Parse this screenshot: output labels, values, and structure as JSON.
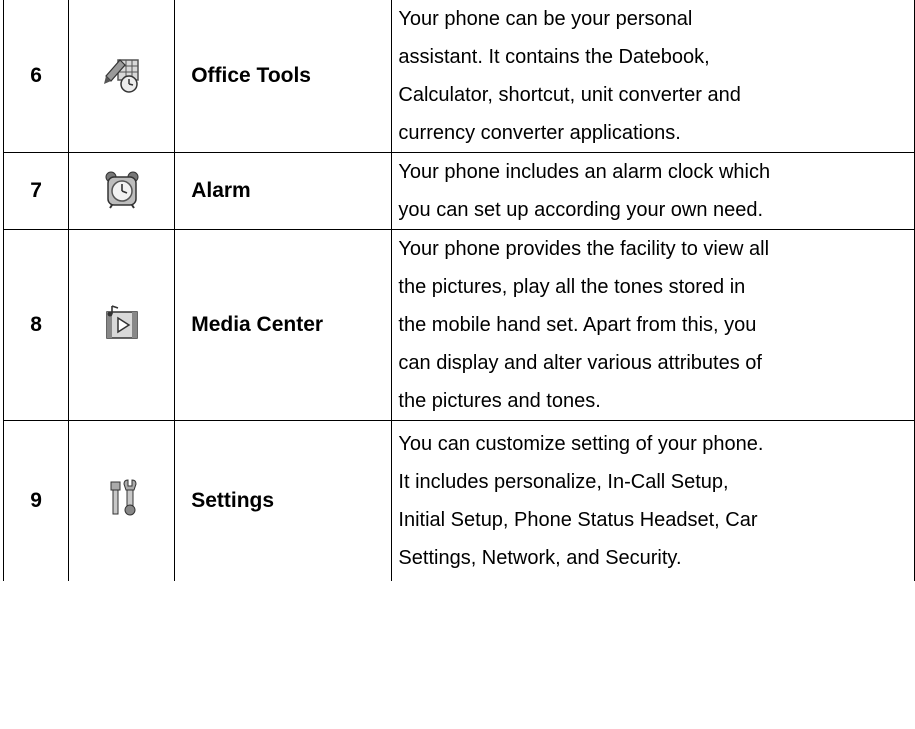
{
  "rows": [
    {
      "number": "6",
      "icon": "office-tools-icon",
      "name": "Office Tools",
      "lines": [
        "Your phone can be your personal",
        "assistant. It contains the Datebook,",
        "Calculator, shortcut, unit converter and",
        "currency converter applications."
      ]
    },
    {
      "number": "7",
      "icon": "alarm-clock-icon",
      "name": "Alarm",
      "lines": [
        "Your phone includes an alarm clock which",
        "you can set up according your own need."
      ]
    },
    {
      "number": "8",
      "icon": "media-center-icon",
      "name": "Media Center",
      "lines": [
        "Your phone provides the facility to view all",
        "the pictures, play all the tones stored in",
        "the mobile hand set. Apart from this, you",
        "can display and alter various attributes of",
        "the pictures and tones."
      ]
    },
    {
      "number": "9",
      "icon": "settings-tools-icon",
      "name": "Settings",
      "lines": [
        "You can customize setting of your phone.",
        "It includes personalize, In-Call Setup,",
        "Initial Setup, Phone Status Headset, Car",
        "Settings, Network, and Security."
      ]
    }
  ]
}
